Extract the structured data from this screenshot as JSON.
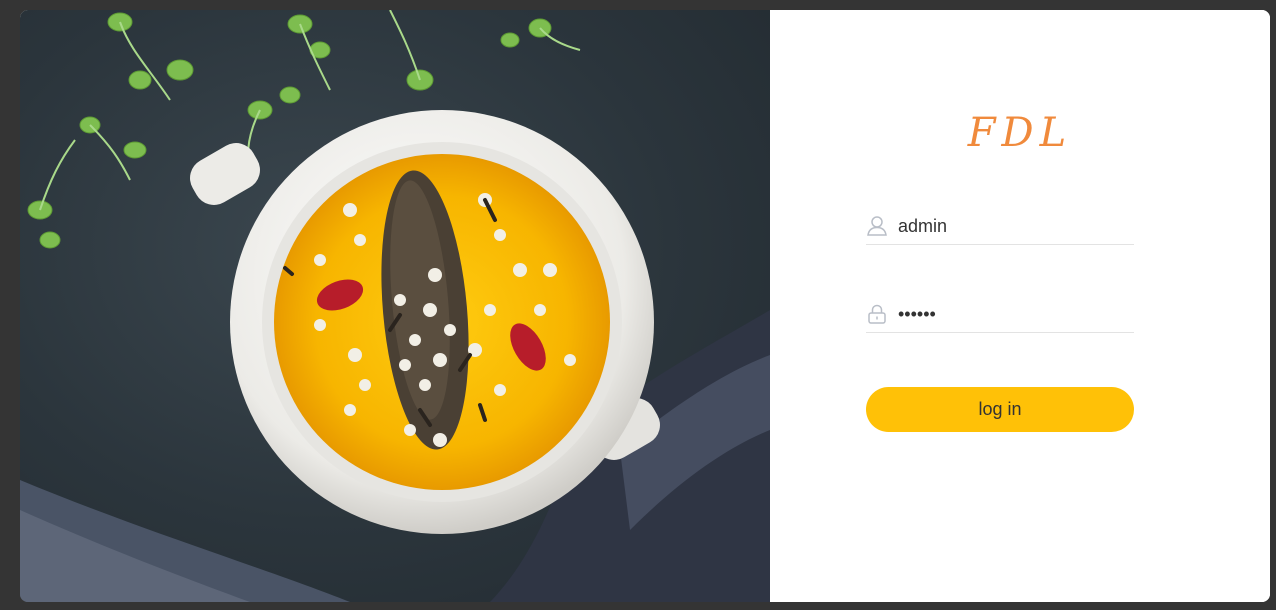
{
  "brand": {
    "logo_text": "FDL",
    "accent_color": "#f08a3c"
  },
  "login": {
    "username_value": "admin",
    "username_icon": "user-icon",
    "password_value": "••••••",
    "password_icon": "lock-icon",
    "submit_label": "log in",
    "button_color": "#ffc107"
  },
  "hero": {
    "subject": "bowl-of-soup-photo"
  }
}
